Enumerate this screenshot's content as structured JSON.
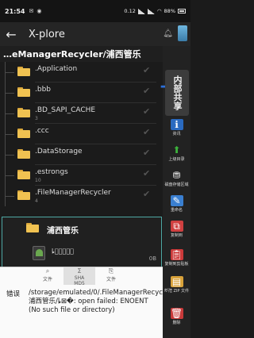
{
  "status": {
    "time": "21:54",
    "net_speed": "0.12\nKB/s",
    "battery": "88%"
  },
  "toolbar": {
    "title": "X-plore",
    "back_icon": "arrow-left-icon"
  },
  "path": "…eManagerRecycler/浦西管乐",
  "folders": [
    {
      "name": ".Application",
      "meta": ""
    },
    {
      "name": ".bbb",
      "meta": ""
    },
    {
      "name": ".BD_SAPI_CACHE",
      "meta": "3"
    },
    {
      "name": ".ccc",
      "meta": ""
    },
    {
      "name": ".DataStorage",
      "meta": ""
    },
    {
      "name": ".estrongs",
      "meta": "10"
    },
    {
      "name": ".FileManagerRecycler",
      "meta": "4"
    }
  ],
  "selected": {
    "folder": "浦西管乐",
    "file": "ȴ\u0000\u0000\u0000\u0000\u0000",
    "size": "0B"
  },
  "sidebar": {
    "vertical_tab": "内部共享",
    "buttons": [
      {
        "label": "资讯",
        "icon": "info-icon"
      },
      {
        "label": "上级目录",
        "icon": "up-icon"
      },
      {
        "label": "磁盘存储区域",
        "icon": "disk-icon"
      },
      {
        "label": "重命名",
        "icon": "rename-icon"
      },
      {
        "label": "复制到",
        "icon": "copy-icon"
      },
      {
        "label": "复制到剪贴板",
        "icon": "clipboard-icon"
      },
      {
        "label": "新建 ZIP 文件",
        "icon": "zip-icon"
      },
      {
        "label": "删除",
        "icon": "delete-icon"
      }
    ]
  },
  "popup": {
    "tabs": [
      {
        "glyph": "⌕",
        "label": "文件"
      },
      {
        "glyph": "Σ",
        "label": "SHA\nMD5"
      },
      {
        "glyph": "⎘",
        "label": "文件"
      }
    ],
    "error_label": "错误",
    "error_text": "/storage/emulated/0/.FileManagerRecycler/浦西管乐/ȴ⊠�: open failed: ENOENT (No such file or directory)"
  }
}
